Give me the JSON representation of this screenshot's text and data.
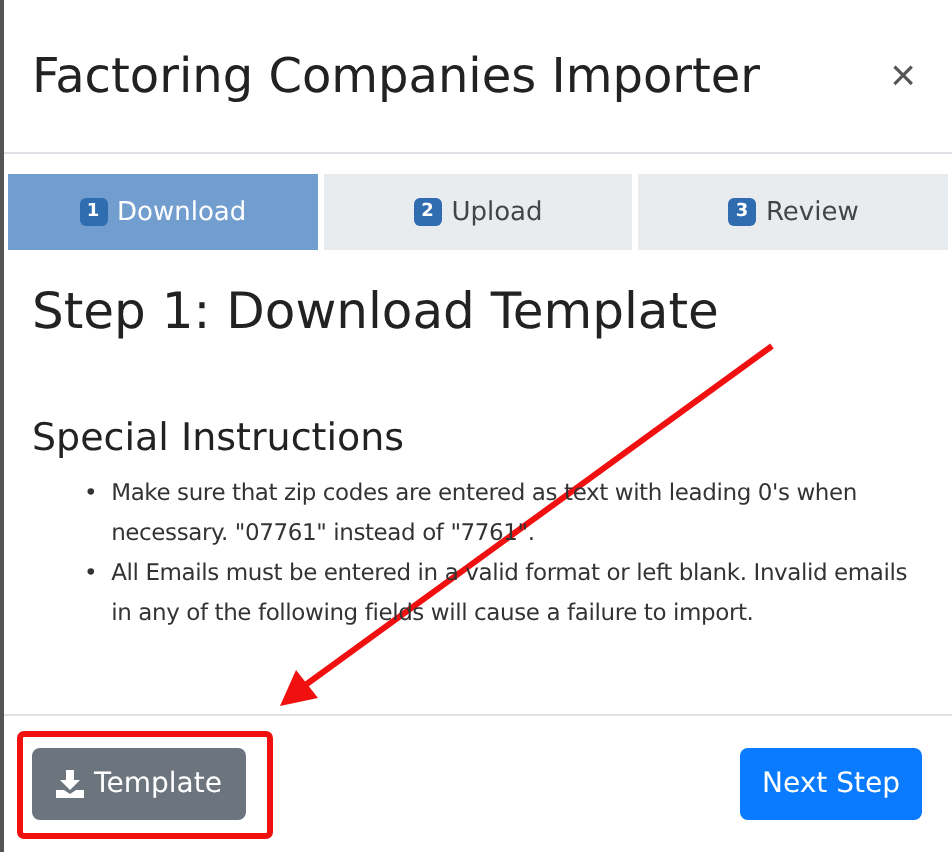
{
  "dialog": {
    "title": "Factoring Companies Importer",
    "close": "×"
  },
  "steps": [
    {
      "number": "1",
      "label": "Download",
      "selected": true
    },
    {
      "number": "2",
      "label": "Upload",
      "selected": false
    },
    {
      "number": "3",
      "label": "Review",
      "selected": false
    }
  ],
  "heading": "Step 1: Download Template",
  "section_title": "Special Instructions",
  "instructions": [
    {
      "bullet": "•",
      "text": "Make sure that zip codes are entered as text with leading 0's when necessary. \"07761\" instead of \"7761\"."
    },
    {
      "bullet": "•",
      "text": "All Emails must be entered in a valid format or left blank. Invalid emails in any of the following fields will cause a failure to import."
    }
  ],
  "buttons": [
    {
      "kind": "secondary",
      "label": "Template"
    },
    {
      "kind": "primary",
      "label": "Next Step"
    }
  ]
}
